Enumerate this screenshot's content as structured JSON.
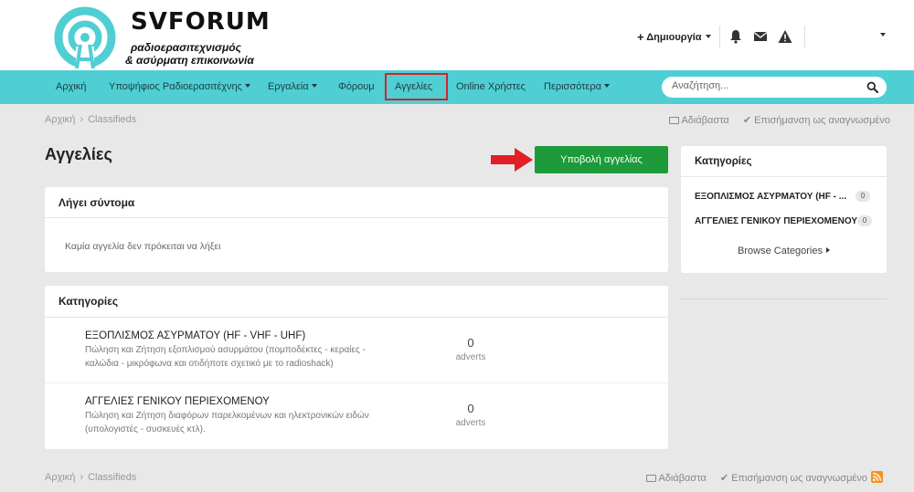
{
  "header": {
    "logo": {
      "name": "SVFORUM",
      "subtitle_line1": "ραδιοερασιτεχνισμός",
      "subtitle_line2": "& ασύρματη επικοινωνία",
      "ring_color": "#4fcfd3"
    },
    "create_label": "Δημιουργία",
    "icons": [
      "plus-icon",
      "bell-icon",
      "envelope-icon",
      "warning-icon",
      "chevron-down-icon"
    ]
  },
  "nav": {
    "accent_color": "#4fcfd3",
    "items": [
      {
        "label": "Αρχική"
      },
      {
        "label": "Υποψήφιος Ραδιοερασιτέχνης"
      },
      {
        "label": "Εργαλεία"
      },
      {
        "label": "Φόρουμ"
      },
      {
        "label": "Αγγελίες"
      },
      {
        "label": "Online Χρήστες"
      },
      {
        "label": "Περισσότερα"
      }
    ],
    "search_placeholder": "Αναζήτηση..."
  },
  "breadcrumb": {
    "home": "Αρχική",
    "current": "Classifieds",
    "activity_label": "Αδιάβαστα",
    "mark_read_label": "Επισήμανση ως αναγνωσμένο"
  },
  "main": {
    "title": "Αγγελίες",
    "submit_label": "Υποβολή αγγελίας",
    "submit_color": "#1d9a3a",
    "expiring": {
      "title": "Λήγει σύντομα",
      "empty_message": "Καμία αγγελία δεν πρόκειται να λήξει"
    },
    "categories": {
      "title": "Κατηγορίες",
      "rows": [
        {
          "name": "ΕΞΟΠΛΙΣΜΟΣ ΑΣΥΡΜΑΤΟΥ (HF - VHF - UHF)",
          "description": "Πώληση και Ζήτηση εξοπλισμού ασυρμάτου (πομποδέκτες - κεραίες - καλώδια - μικρόφωνα και οτιδήποτε σχετικό με το radioshack)",
          "count": "0",
          "unit": "adverts"
        },
        {
          "name": "ΑΓΓΕΛΙΕΣ ΓΕΝΙΚΟΥ ΠΕΡΙΕΧΟΜΕΝΟΥ",
          "description": "Πώληση και Ζήτηση διαφόρων παρελκομένων και ηλεκτρονικών ειδών (υπολογιστές - συσκευές κτλ).",
          "count": "0",
          "unit": "adverts"
        }
      ]
    }
  },
  "sidebar": {
    "title": "Κατηγορίες",
    "items": [
      {
        "label": "ΕΞΟΠΛΙΣΜΟΣ ΑΣΥΡΜΑΤΟΥ (HF - ...",
        "count": "0"
      },
      {
        "label": "ΑΓΓΕΛΙΕΣ ΓΕΝΙΚΟΥ ΠΕΡΙΕΧΟΜΕΝΟΥ",
        "count": "0"
      }
    ],
    "browse_label": "Browse Categories"
  },
  "highlight_color": "#d3232a",
  "rss_color": "#f2931e"
}
